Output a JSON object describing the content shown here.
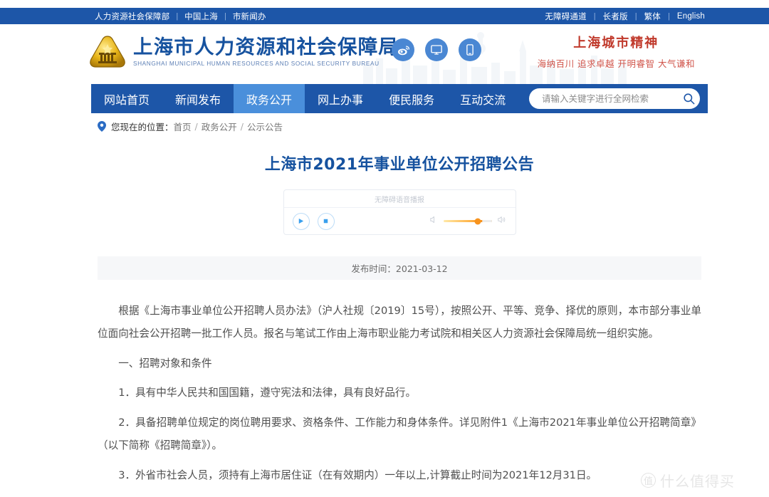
{
  "topbar": {
    "left_links": [
      "人力资源社会保障部",
      "中国上海",
      "市新闻办"
    ],
    "right_links": [
      "无障碍通道",
      "长者版",
      "繁体",
      "English"
    ],
    "bg_color": "#1d56a8"
  },
  "header": {
    "logo_cn": "上海市人力资源和社会保障局",
    "logo_en": "SHANGHAI MUNICIPAL HUMAN RESOURCES AND SOCIAL SECURITY BUREAU",
    "logo_color": "#16529f",
    "social_icons": [
      "weibo-icon",
      "desktop-icon",
      "mobile-icon"
    ],
    "social_color": "#4a87d3",
    "spirit_title": "上海城市精神",
    "spirit_sub": "海纳百川 追求卓越 开明睿智 大气谦和",
    "spirit_color": "#c0392b"
  },
  "nav": {
    "items": [
      {
        "label": "网站首页",
        "active": false
      },
      {
        "label": "新闻发布",
        "active": false
      },
      {
        "label": "政务公开",
        "active": true
      },
      {
        "label": "网上办事",
        "active": false
      },
      {
        "label": "便民服务",
        "active": false
      },
      {
        "label": "互动交流",
        "active": false
      }
    ],
    "active_color": "#4a8fdb",
    "bg_color": "#1d56a8"
  },
  "search": {
    "placeholder": "请输入关键字进行全网检索",
    "value": "",
    "icon": "search-icon"
  },
  "breadcrumb": {
    "icon": "location-pin-icon",
    "label": "您现在的位置：",
    "segments": [
      "首页",
      "政务公开",
      "公示公告"
    ],
    "separator": "/"
  },
  "article": {
    "title": "上海市2021年事业单位公开招聘公告",
    "publish_label": "发布时间：2021-03-12",
    "paragraphs": [
      "根据《上海市事业单位公开招聘人员办法》（沪人社规〔2019〕15号），按照公开、平等、竞争、择优的原则，本市部分事业单位面向社会公开招聘一批工作人员。报名与笔试工作由上海市职业能力考试院和相关区人力资源社会保障局统一组织实施。",
      "一、招聘对象和条件",
      "1．具有中华人民共和国国籍，遵守宪法和法律，具有良好品行。",
      "2．具备招聘单位规定的岗位聘用要求、资格条件、工作能力和身体条件。详见附件1《上海市2021年事业单位公开招聘简章》（以下简称《招聘简章》）。",
      "3．外省市社会人员，须持有上海市居住证（在有效期内）一年以上,计算截止时间为2021年12月31日。"
    ]
  },
  "player": {
    "title": "无障碍语音播报",
    "play_icon": "play-icon",
    "stop_icon": "stop-icon",
    "volume_mute_icon": "volume-mute-icon",
    "volume_up_icon": "volume-up-icon",
    "volume_percent": 72,
    "accent_color": "#f7931e"
  },
  "watermark": {
    "badge": "值",
    "text": "什么值得买"
  }
}
